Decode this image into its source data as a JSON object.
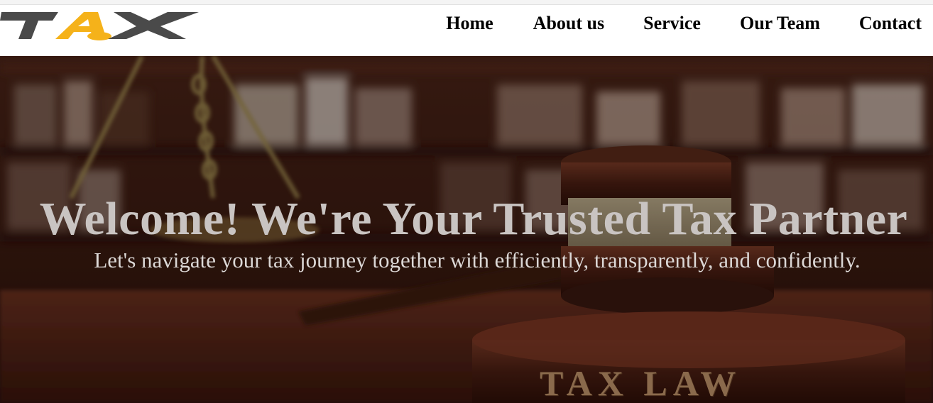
{
  "brand": {
    "logo_text": "TAX",
    "colors": {
      "dark": "#4a4a4a",
      "accent": "#f5b21a"
    }
  },
  "nav": {
    "items": [
      {
        "label": "Home"
      },
      {
        "label": "About us"
      },
      {
        "label": "Service"
      },
      {
        "label": "Our Team"
      },
      {
        "label": "Contact"
      }
    ]
  },
  "hero": {
    "title": "Welcome! We're Your Trusted Tax Partner",
    "subtitle": "Let's navigate your tax journey together with efficiently, transparently, and confidently.",
    "image_engraving": "TAX LAW"
  }
}
